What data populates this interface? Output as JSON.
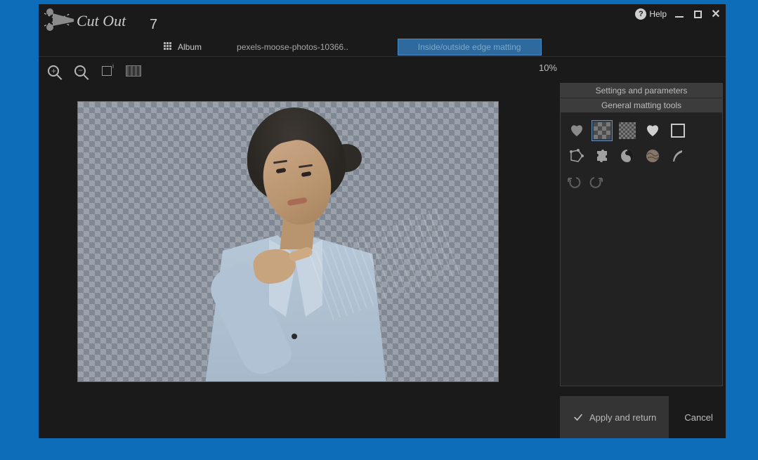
{
  "app": {
    "name": "Cut Out",
    "version": "7"
  },
  "window": {
    "help_label": "Help"
  },
  "secbar": {
    "album_label": "Album",
    "filename": "pexels-moose-photos-10366..",
    "mode_label": "Inside/outside edge matting"
  },
  "toolbar": {
    "zoom_readout": "10%"
  },
  "side": {
    "header1": "Settings and parameters",
    "header2": "General matting tools"
  },
  "actions": {
    "apply_label": "Apply and return",
    "cancel_label": "Cancel"
  }
}
